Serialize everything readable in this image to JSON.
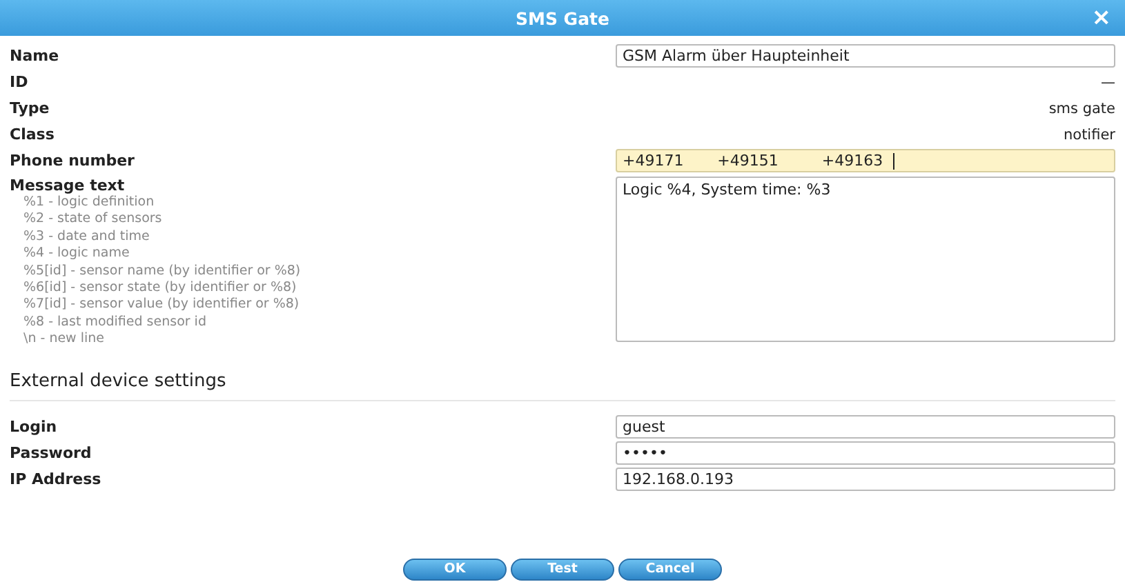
{
  "window": {
    "title": "SMS Gate",
    "close": "×"
  },
  "fields": [
    {
      "kind": "input",
      "label": "Name",
      "value": "GSM Alarm über Haupteinheit",
      "focused": false
    },
    {
      "kind": "static",
      "label": "ID",
      "value": "—"
    },
    {
      "kind": "static",
      "label": "Type",
      "value": "sms gate"
    },
    {
      "kind": "static",
      "label": "Class",
      "value": "notifier"
    },
    {
      "kind": "input",
      "label": "Phone number",
      "value": "+49171       +49151         +49163  ",
      "focused": true
    },
    {
      "kind": "textarea",
      "label": "Message text",
      "value": "Logic %4, System time: %3",
      "hints": [
        "%1 - logic definition",
        "%2 - state of sensors",
        "%3 - date and time",
        "%4 - logic name",
        "%5[id] - sensor name (by identifier or %8)",
        "%6[id] - sensor state (by identifier or %8)",
        "%7[id] - sensor value (by identifier or %8)",
        "%8 - last modified sensor id",
        "\\n - new line"
      ]
    }
  ],
  "section": {
    "title": "External device settings",
    "fields": [
      {
        "kind": "input",
        "label": "Login",
        "value": "guest",
        "focused": false
      },
      {
        "kind": "input",
        "label": "Password",
        "value": "•••••",
        "focused": false
      },
      {
        "kind": "input",
        "label": "IP Address",
        "value": "192.168.0.193",
        "focused": false
      }
    ]
  },
  "buttons": [
    "OK",
    "Test",
    "Cancel"
  ]
}
